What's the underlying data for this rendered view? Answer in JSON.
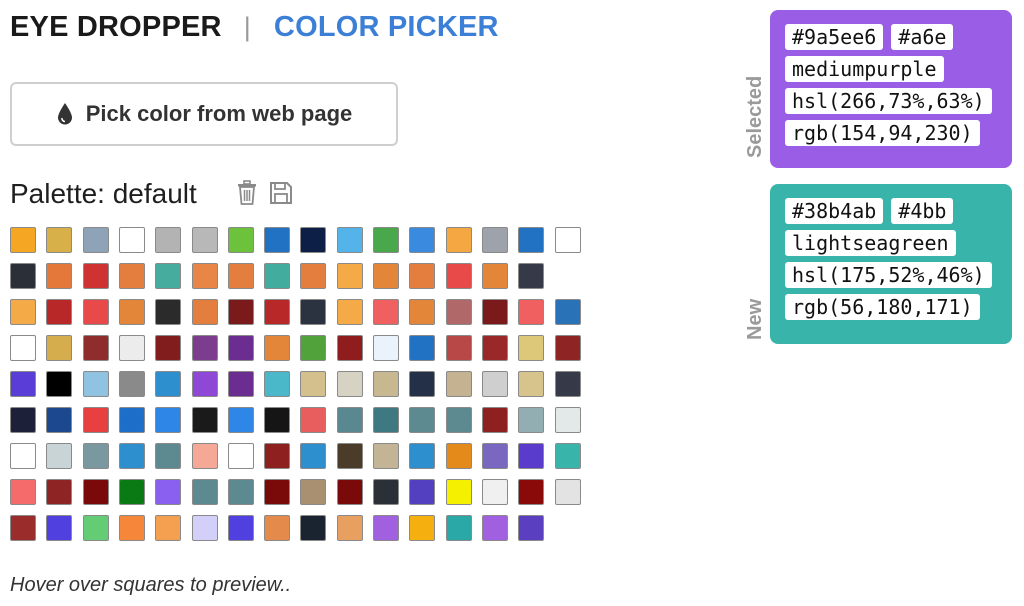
{
  "tabs": {
    "eye_dropper": "EYE DROPPER",
    "separator": "|",
    "color_picker": "COLOR PICKER"
  },
  "pick_button": {
    "label": "Pick color from web page",
    "icon": "droplet-icon"
  },
  "palette": {
    "title": "Palette: default",
    "icons": [
      "trash-icon",
      "save-icon"
    ],
    "rows": [
      [
        "#f5a623",
        "#d8b04a",
        "#8fa3b8",
        "#ffffff",
        "#b3b3b3",
        "#b8b8b8",
        "#6cc23a",
        "#2272c3",
        "#0d1f47",
        "#54b3e8",
        "#4aa84c",
        "#3a8ae0",
        "#f5a742",
        "#9ea3ab",
        "#2272c3",
        "#ffffff"
      ],
      [
        "#2b3038",
        "#e4783a",
        "#cf3232",
        "#e47e3e",
        "#46ad9e",
        "#e88648",
        "#e47e3e",
        "#42ad9e",
        "#e47e3e",
        "#f5aa48",
        "#e4863a",
        "#e47e3e",
        "#e84a4a",
        "#e4863a",
        "#363a48"
      ],
      [
        "#f5aa48",
        "#b82828",
        "#e84a4a",
        "#e4863a",
        "#2b2b2b",
        "#e47e3e",
        "#7a1a1a",
        "#b82828",
        "#2b3240",
        "#f5aa48",
        "#f06060",
        "#e4863a",
        "#b06868",
        "#7a1a1a",
        "#f06060",
        "#2a72b8"
      ],
      [
        "#ffffff",
        "#d6ad4c",
        "#8f2c2c",
        "#ececec",
        "#821d1d",
        "#7c3d8f",
        "#6b2d8f",
        "#e4863a",
        "#52a23c",
        "#8f1d1d",
        "#eaf2fb",
        "#2272c3",
        "#b84848",
        "#9b2828",
        "#dcc878",
        "#8f2424"
      ],
      [
        "#5a3cd6",
        "#000000",
        "#90c2e2",
        "#8a8a8a",
        "#2e8fcf",
        "#8f48d6",
        "#6b2d8f",
        "#4ab8c8",
        "#d4c08c",
        "#d6d2c4",
        "#c8b890",
        "#243048",
        "#c4b290",
        "#cfcfcf",
        "#d6c48c",
        "#363a48"
      ],
      [
        "#1c2038",
        "#1c4890",
        "#e84040",
        "#1c6ec8",
        "#2e86e6",
        "#1a1a1a",
        "#2e86e6",
        "#151515",
        "#e85e5e",
        "#5a8890",
        "#3e7880",
        "#5c8a90",
        "#5c8a90",
        "#8f2020",
        "#93aeb2",
        "#e3e8e8"
      ],
      [
        "#ffffff",
        "#c9d4d6",
        "#7a98a0",
        "#2e8fcf",
        "#5c8a90",
        "#f5a896",
        "#ffffff",
        "#8f2020",
        "#2e8fcf",
        "#4a3c28",
        "#c4b496",
        "#2e8fcf",
        "#e48a1a",
        "#7a68c0",
        "#5a3ccc",
        "#38b4ab"
      ],
      [
        "#f56a6a",
        "#8f2424",
        "#7a0a0a",
        "#0a7a14",
        "#8a60f0",
        "#5c8a90",
        "#5c8a90",
        "#7a0a0a",
        "#a89070",
        "#7a0a0a",
        "#2b3038",
        "#5240c0",
        "#f5f000",
        "#f0f0f0",
        "#8a0a0a",
        "#e3e3e3"
      ],
      [
        "#9a2c2c",
        "#5040e0",
        "#64cc74",
        "#f5863a",
        "#f5a050",
        "#d2d0f8",
        "#5040e0",
        "#e48a4a",
        "#1a2430",
        "#e8a060",
        "#a060e0",
        "#f5b010",
        "#2aa8a8",
        "#a060e0",
        "#5a40c0"
      ]
    ]
  },
  "hint": "Hover over squares to preview..",
  "selected": {
    "label": "Selected",
    "color": "#9a5ee6",
    "hex": "#9a5ee6",
    "hex_short": "#a6e",
    "name": "mediumpurple",
    "hsl": "hsl(266,73%,63%)",
    "rgb": "rgb(154,94,230)"
  },
  "new": {
    "label": "New",
    "color": "#38b4ab",
    "hex": "#38b4ab",
    "hex_short": "#4bb",
    "name": "lightseagreen",
    "hsl": "hsl(175,52%,46%)",
    "rgb": "rgb(56,180,171)"
  }
}
